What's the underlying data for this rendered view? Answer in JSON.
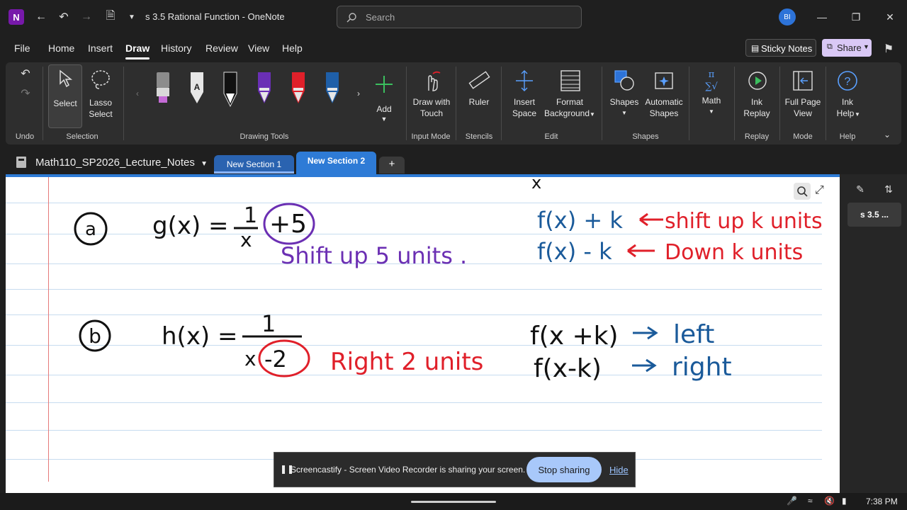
{
  "titlebar": {
    "title": "s 3.5 Rational Function  -  OneNote",
    "search_placeholder": "Search",
    "avatar_initials": "BI"
  },
  "menu": {
    "items": [
      "File",
      "Home",
      "Insert",
      "Draw",
      "History",
      "Review",
      "View",
      "Help"
    ],
    "active": "Draw",
    "sticky_notes": "Sticky Notes",
    "share": "Share"
  },
  "ribbon": {
    "select": "Select",
    "lasso_1": "Lasso",
    "lasso_2": "Select",
    "add": "Add",
    "draw_touch_1": "Draw with",
    "draw_touch_2": "Touch",
    "ruler": "Ruler",
    "insert_space_1": "Insert",
    "insert_space_2": "Space",
    "format_bg_1": "Format",
    "format_bg_2": "Background",
    "shapes": "Shapes",
    "auto_shapes_1": "Automatic",
    "auto_shapes_2": "Shapes",
    "math": "Math",
    "ink_replay_1": "Ink",
    "ink_replay_2": "Replay",
    "full_page_1": "Full Page",
    "full_page_2": "View",
    "ink_help_1": "Ink",
    "ink_help_2": "Help",
    "groups": {
      "undo": "Undo",
      "selection": "Selection",
      "drawing_tools": "Drawing Tools",
      "input_mode": "Input Mode",
      "stencils": "Stencils",
      "edit": "Edit",
      "shapes": "Shapes",
      "replay": "Replay",
      "mode": "Mode",
      "help": "Help"
    },
    "pens": [
      {
        "name": "highlighter-gray",
        "color": "#9a9a9a",
        "tip": "#c46bd6"
      },
      {
        "name": "pen-white",
        "color": "#e6e6e6",
        "tip": "#e6e6e6"
      },
      {
        "name": "pen-black",
        "color": "#111111",
        "tip": "#ffffff"
      },
      {
        "name": "pen-purple",
        "color": "#6a2fb5",
        "tip": "#6a2fb5"
      },
      {
        "name": "pen-red",
        "color": "#e0202a",
        "tip": "#e0202a"
      },
      {
        "name": "pen-blue",
        "color": "#1f5fa8",
        "tip": "#1f5fa8"
      }
    ]
  },
  "sections": {
    "notebook": "Math110_SP2026_Lecture_Notes",
    "tabs": [
      "New Section 1",
      "New Section 2"
    ],
    "active_tab": "New Section 2",
    "add_label": "+"
  },
  "page_list": {
    "current": "s 3.5 ..."
  },
  "ink": {
    "a_label": "a",
    "g_lhs": "g(x) =",
    "g_num": "1",
    "g_den": "x",
    "g_plus": "+5",
    "g_note": "Shift up 5 units .",
    "b_label": "b",
    "h_lhs": "h(x) =",
    "h_num": "1",
    "h_den_x": "x",
    "h_den_rest": "-2",
    "h_note": "Right 2 units",
    "rule1_lhs": "f(x) + k",
    "rule1_rhs": "shift up k units",
    "rule2_lhs": "f(x) - k",
    "rule2_rhs": "Down k units",
    "rule3_lhs": "f(x +k)",
    "rule3_rhs": "left",
    "rule4_lhs": "f(x-k)",
    "rule4_rhs": "right",
    "top_stray": "x",
    "colors": {
      "black": "#111111",
      "purple": "#6b2fb3",
      "red": "#e0202a",
      "blue": "#1a5a9a"
    }
  },
  "share_banner": {
    "text": "Screencastify - Screen Video Recorder is sharing your screen.",
    "stop": "Stop sharing",
    "hide": "Hide"
  },
  "taskbar": {
    "time": "7:38 PM"
  }
}
